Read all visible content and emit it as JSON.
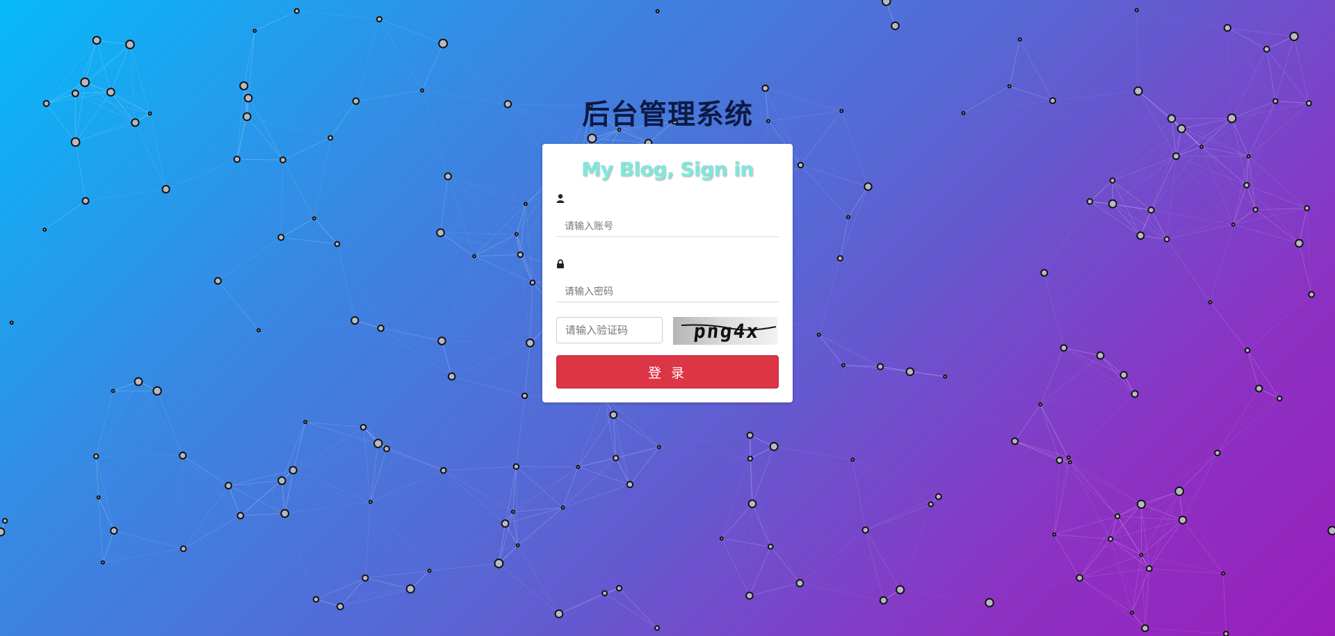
{
  "page": {
    "title": "后台管理系统"
  },
  "login_form": {
    "heading": "My Blog, Sign in",
    "account": {
      "icon": "user-icon",
      "placeholder": "请输入账号",
      "value": ""
    },
    "password": {
      "icon": "lock-icon",
      "placeholder": "请输入密码",
      "value": ""
    },
    "captcha": {
      "placeholder": "请输入验证码",
      "value": "",
      "image_text": "png4x"
    },
    "submit_label": "登 录"
  },
  "colors": {
    "gradient_start": "#06b9f9",
    "gradient_end": "#9a1ebb",
    "heading_accent": "#7ee8dc",
    "button": "#dc3545",
    "title": "#0c1a44"
  }
}
